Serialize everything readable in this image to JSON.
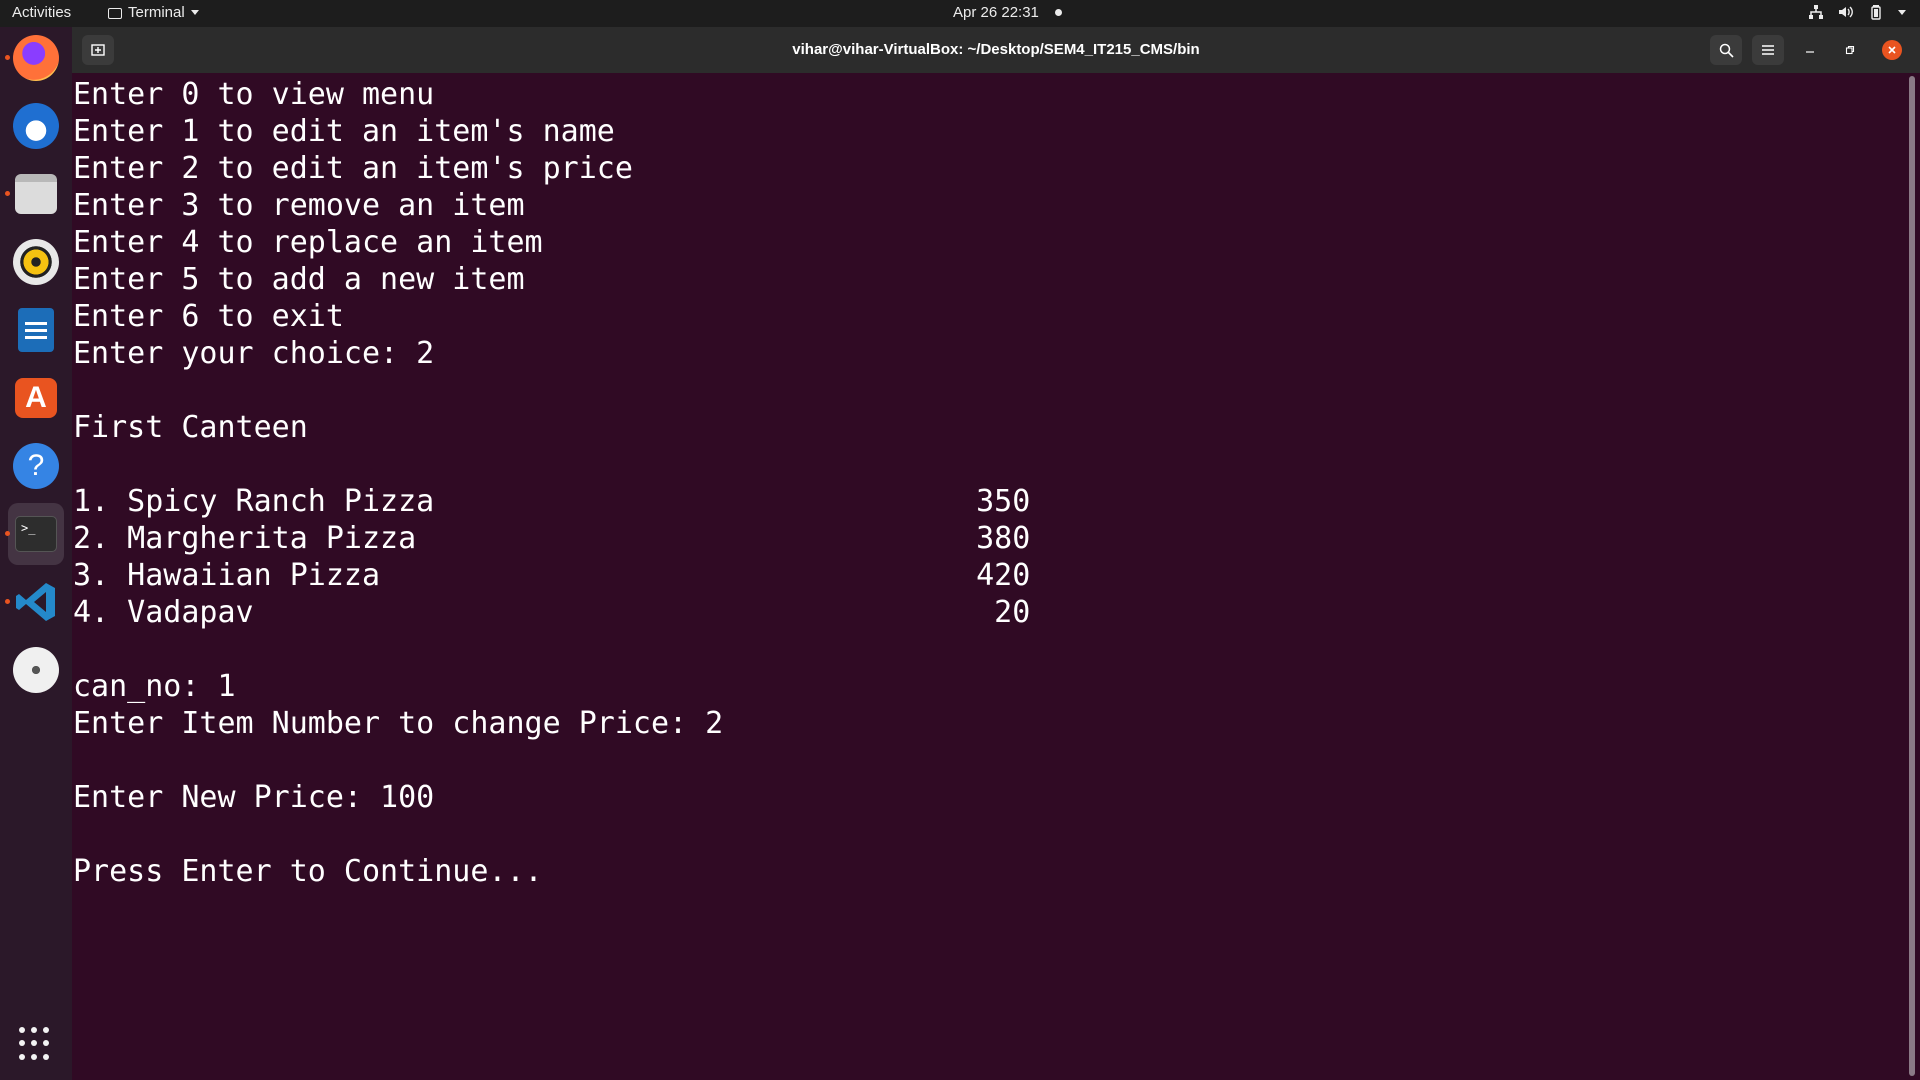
{
  "topbar": {
    "activities": "Activities",
    "app_name": "Terminal",
    "datetime": "Apr 26  22:31"
  },
  "dock": {
    "apps": [
      {
        "name": "Firefox",
        "icon": "firefox-icon",
        "running": true
      },
      {
        "name": "Thunderbird",
        "icon": "thunderbird-icon",
        "running": false
      },
      {
        "name": "Files",
        "icon": "files-icon",
        "running": true
      },
      {
        "name": "Rhythmbox",
        "icon": "rhythmbox-icon",
        "running": false
      },
      {
        "name": "LibreOffice Writer",
        "icon": "writer-icon",
        "running": false
      },
      {
        "name": "Ubuntu Software",
        "icon": "software-icon",
        "running": false
      },
      {
        "name": "Help",
        "icon": "help-icon",
        "running": false
      },
      {
        "name": "Terminal",
        "icon": "terminal-icon",
        "running": true
      },
      {
        "name": "Visual Studio Code",
        "icon": "vscode-icon",
        "running": true
      },
      {
        "name": "Disc",
        "icon": "disc-icon",
        "running": false
      }
    ]
  },
  "window": {
    "title": "vihar@vihar-VirtualBox: ~/Desktop/SEM4_IT215_CMS/bin"
  },
  "terminal": {
    "lines": [
      "Enter 0 to view menu",
      "Enter 1 to edit an item's name",
      "Enter 2 to edit an item's price",
      "Enter 3 to remove an item",
      "Enter 4 to replace an item",
      "Enter 5 to add a new item",
      "Enter 6 to exit",
      "Enter your choice: 2",
      "",
      "First Canteen",
      "",
      "1. Spicy Ranch Pizza                              350",
      "2. Margherita Pizza                               380",
      "3. Hawaiian Pizza                                 420",
      "4. Vadapav                                         20",
      "",
      "can_no: 1",
      "Enter Item Number to change Price: 2",
      "",
      "Enter New Price: 100",
      "",
      "Press Enter to Continue..."
    ]
  },
  "colors": {
    "terminal_bg": "#300a24",
    "accent": "#e95420",
    "titlebar_bg": "#2c2c2c",
    "topbar_bg": "#1d1d1d"
  }
}
